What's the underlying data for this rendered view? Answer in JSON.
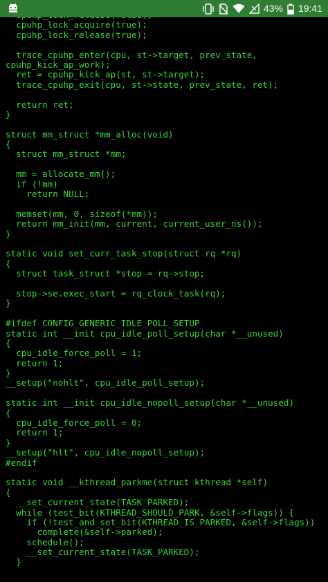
{
  "status_bar": {
    "background": "#2e7d32",
    "left_icon": "android-debug-icon",
    "icons": [
      "vibrate-icon",
      "no-sim-icon",
      "wifi-icon",
      "signal-icon",
      "battery-icon"
    ],
    "battery_percent": "43%",
    "time": "19:41"
  },
  "terminal": {
    "text_color": "#3bd43b",
    "background": "#000000",
    "lines": [
      "  cpuhp_lock_release(false);",
      "  cpuhp_lock_acquire(true);",
      "  cpuhp_lock_release(true);",
      "",
      "  trace_cpuhp_enter(cpu, st->target, prev_state,",
      "cpuhp_kick_ap_work);",
      "  ret = cpuhp_kick_ap(st, st->target);",
      "  trace_cpuhp_exit(cpu, st->state, prev_state, ret);",
      "",
      "  return ret;",
      "}",
      "",
      "struct mm_struct *mm_alloc(void)",
      "{",
      "  struct mm_struct *mm;",
      "",
      "  mm = allocate_mm();",
      "  if (!mm)",
      "    return NULL;",
      "",
      "  memset(mm, 0, sizeof(*mm));",
      "  return mm_init(mm, current, current_user_ns());",
      "}",
      "",
      "static void set_curr_task_stop(struct rq *rq)",
      "{",
      "  struct task_struct *stop = rq->stop;",
      "",
      "  stop->se.exec_start = rq_clock_task(rq);",
      "}",
      "",
      "#ifdef CONFIG_GENERIC_IDLE_POLL_SETUP",
      "static int __init cpu_idle_poll_setup(char *__unused)",
      "{",
      "  cpu_idle_force_poll = 1;",
      "  return 1;",
      "}",
      "__setup(\"nohlt\", cpu_idle_poll_setup);",
      "",
      "static int __init cpu_idle_nopoll_setup(char *__unused)",
      "{",
      "  cpu_idle_force_poll = 0;",
      "  return 1;",
      "}",
      "__setup(\"hlt\", cpu_idle_nopoll_setup);",
      "#endif",
      "",
      "static void __kthread_parkme(struct kthread *self)",
      "{",
      "  __set_current_state(TASK_PARKED);",
      "  while (test_bit(KTHREAD_SHOULD_PARK, &self->flags)) {",
      "    if (!test_and_set_bit(KTHREAD_IS_PARKED, &self->flags))",
      "      complete(&self->parked);",
      "    schedule();",
      "    __set_current_state(TASK_PARKED);",
      "  }"
    ]
  }
}
